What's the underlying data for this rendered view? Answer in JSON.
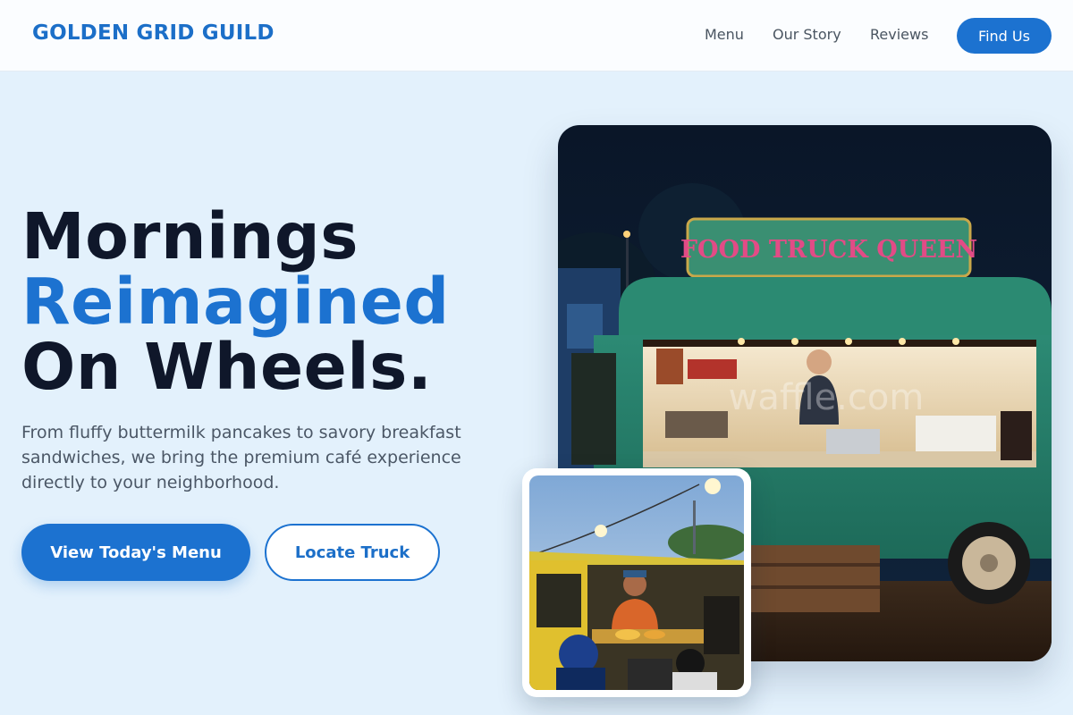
{
  "nav": {
    "logo": "GOLDEN GRID GUILD",
    "links": [
      "Menu",
      "Our Story",
      "Reviews"
    ],
    "cta": "Find Us"
  },
  "hero": {
    "title_line1": "Mornings",
    "title_line2": "Reimagined",
    "title_line3": "On Wheels.",
    "description": "From fluffy buttermilk pancakes to savory breakfast sandwiches, we bring the premium café experience directly to your neighborhood.",
    "primary_button": "View Today's Menu",
    "secondary_button": "Locate Truck"
  },
  "images": {
    "main_sign": "FOOD TRUCK QUEEN",
    "main_watermark": "waffle.com"
  },
  "colors": {
    "accent": "#1c72d0",
    "background": "#e3f1fc",
    "heading": "#0f172a"
  }
}
